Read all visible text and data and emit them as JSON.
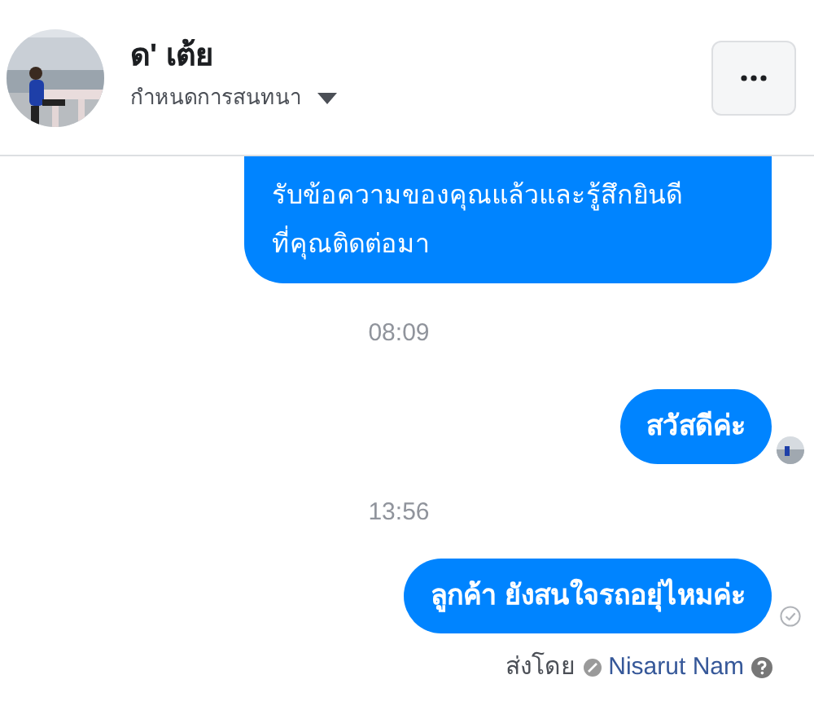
{
  "header": {
    "name": "ด' เต้ย",
    "subtitle": "กำหนดการสนทนา"
  },
  "thread": [
    {
      "kind": "message",
      "text": "รับข้อความของคุณแล้วและรู้สึกยินดีที่คุณติดต่อมา",
      "seen": false,
      "sent": false,
      "cut_top": true
    },
    {
      "kind": "timestamp",
      "text": "08:09"
    },
    {
      "kind": "message",
      "text": "สวัสดีค่ะ",
      "seen": true,
      "sent": false,
      "cut_top": false
    },
    {
      "kind": "timestamp",
      "text": "13:56"
    },
    {
      "kind": "message",
      "text": "ลูกค้า ยังสนใจรถอยุ่ไหมค่ะ",
      "seen": false,
      "sent": true,
      "cut_top": false
    }
  ],
  "sent_by": {
    "label": "ส่งโดย",
    "name": "Nisarut Nam"
  }
}
